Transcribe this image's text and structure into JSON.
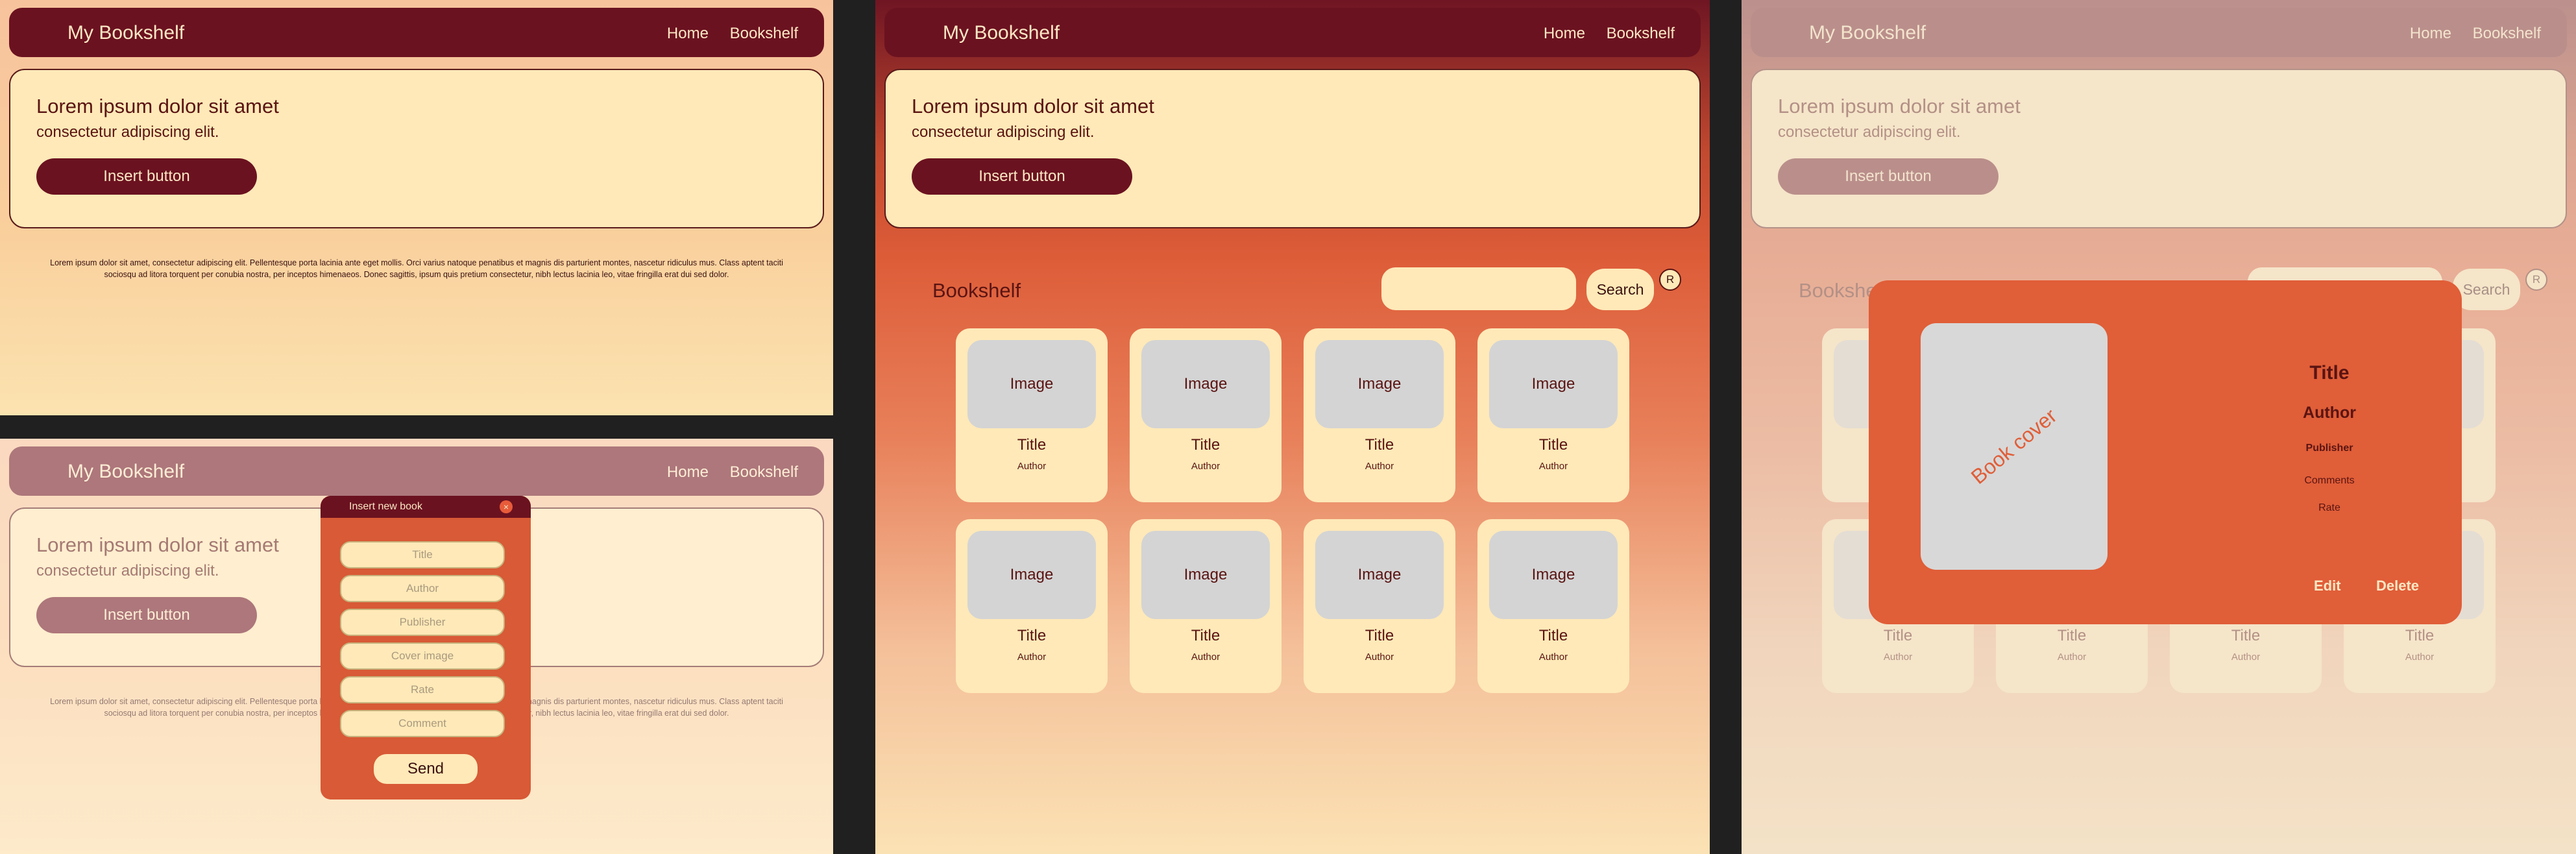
{
  "app": {
    "brand": "My Bookshelf",
    "nav": [
      "Home",
      "Bookshelf"
    ]
  },
  "hero": {
    "title": "Lorem ipsum dolor sit amet",
    "subtitle": "consectetur adipiscing elit.",
    "button": "Insert button"
  },
  "footer_text": "Lorem ipsum dolor sit amet, consectetur adipiscing elit. Pellentesque  porta lacinia ante eget mollis. Orci varius natoque penatibus et magnis  dis parturient montes, nascetur ridiculus mus. Class aptent taciti  sociosqu ad litora torquent per conubia nostra, per inceptos himenaeos.  Donec sagittis, ipsum quis pretium consectetur, nibh lectus lacinia leo, vitae fringilla erat dui sed dolor.",
  "bookshelf": {
    "title": "Bookshelf",
    "search_button": "Search",
    "reset_badge": "R",
    "books": [
      {
        "image": "Image",
        "title": "Title",
        "author": "Author"
      },
      {
        "image": "Image",
        "title": "Title",
        "author": "Author"
      },
      {
        "image": "Image",
        "title": "Title",
        "author": "Author"
      },
      {
        "image": "Image",
        "title": "Title",
        "author": "Author"
      },
      {
        "image": "Image",
        "title": "Title",
        "author": "Author"
      },
      {
        "image": "Image",
        "title": "Title",
        "author": "Author"
      },
      {
        "image": "Image",
        "title": "Title",
        "author": "Author"
      },
      {
        "image": "Image",
        "title": "Title",
        "author": "Author"
      }
    ]
  },
  "insert_modal": {
    "title": "Insert new book",
    "close": "×",
    "fields": [
      "Title",
      "Author",
      "Publisher",
      "Cover image",
      "Rate",
      "Comment"
    ],
    "send": "Send"
  },
  "detail_modal": {
    "cover": "Book cover",
    "title": "Title",
    "author": "Author",
    "publisher": "Publisher",
    "comments": "Comments",
    "rate": "Rate",
    "edit": "Edit",
    "delete": "Delete"
  },
  "colors": {
    "navbar": "#6b1220",
    "cream": "#ffe9b8",
    "accent": "#e05e38",
    "text_dark": "#5a1412"
  }
}
